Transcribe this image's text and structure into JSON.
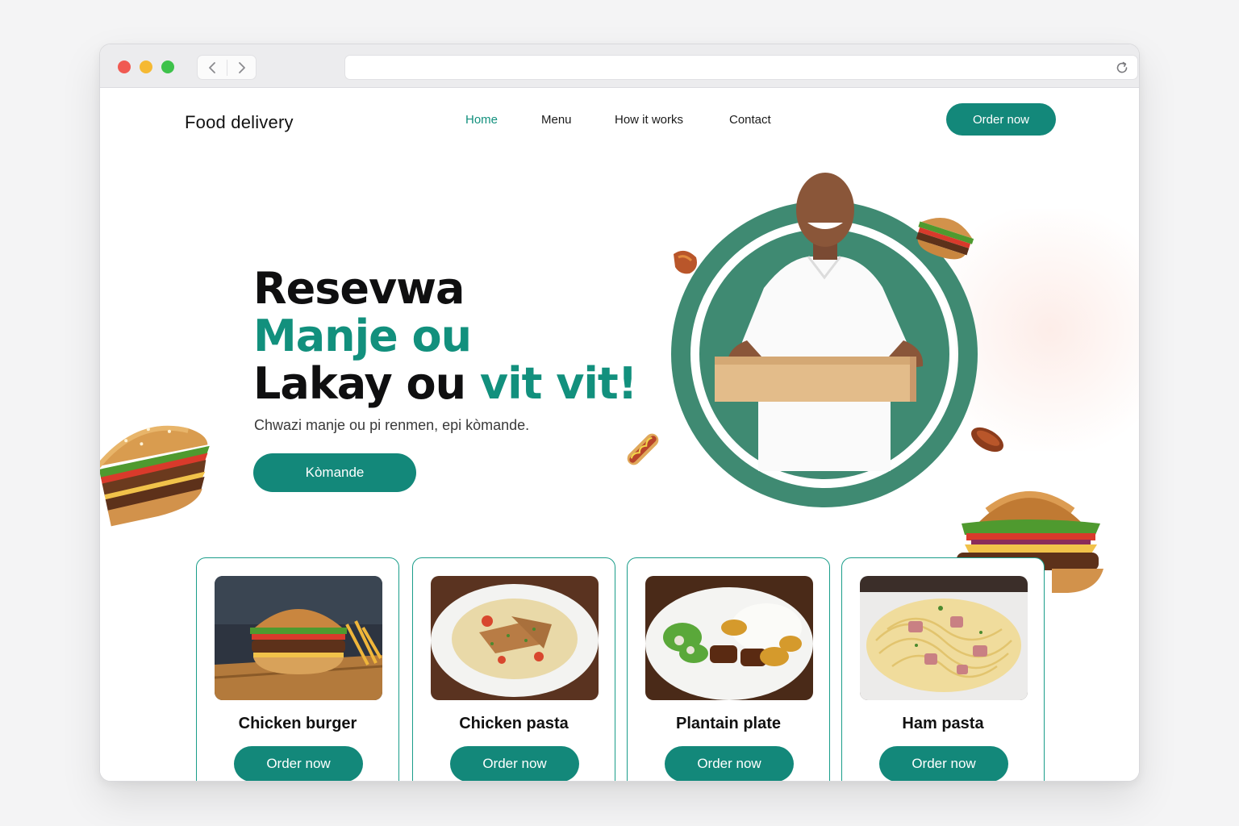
{
  "browser": {
    "icons": {
      "back": "chevron-left-icon",
      "forward": "chevron-right-icon",
      "reload": "reload-icon"
    }
  },
  "header": {
    "brand": "Food delivery",
    "nav": [
      {
        "label": "Home",
        "active": true
      },
      {
        "label": "Menu",
        "active": false
      },
      {
        "label": "How it works",
        "active": false
      },
      {
        "label": "Contact",
        "active": false
      }
    ],
    "cta": "Order now"
  },
  "hero": {
    "line1": "Resevwa",
    "line2": "Manje ou",
    "line3_start": "Lakay ou ",
    "line3_accent": "vit vit!",
    "subtitle": "Chwazi manje ou pi renmen, epi kòmande.",
    "cta": "Kòmande"
  },
  "products": [
    {
      "name": "Chicken burger",
      "button": "Order now"
    },
    {
      "name": "Chicken pasta",
      "button": "Order now"
    },
    {
      "name": "Plantain plate",
      "button": "Order now"
    },
    {
      "name": "Ham pasta",
      "button": "Order now"
    }
  ],
  "colors": {
    "accent": "#13887a",
    "accent_text": "#12907d",
    "ring": "#3f8a72",
    "dark": "#0f0f10"
  }
}
